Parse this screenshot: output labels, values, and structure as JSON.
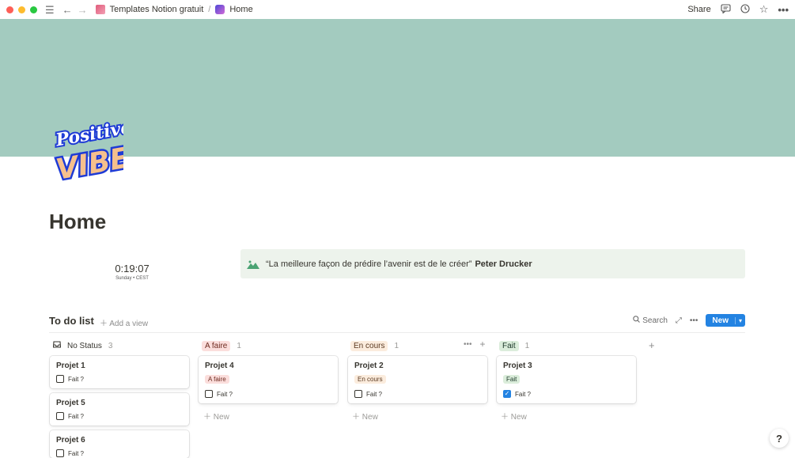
{
  "topbar": {
    "breadcrumb": [
      {
        "label": "Templates Notion gratuit"
      },
      {
        "label": "Home"
      }
    ],
    "separator": "/",
    "share_label": "Share"
  },
  "page": {
    "title": "Home",
    "icon_text_1": "Positive",
    "icon_text_2": "VIBES"
  },
  "clock": {
    "time": "0:19:07",
    "sub": "Sunday • CEST"
  },
  "callout": {
    "quote": "“La meilleure façon de prédire l’avenir est de le créer”",
    "author": "Peter Drucker"
  },
  "database": {
    "title": "To do list",
    "add_view": "Add a view",
    "search_label": "Search",
    "new_label": "New",
    "new_row_label": "New",
    "columns": [
      {
        "label": "No Status",
        "count": "3"
      },
      {
        "label": "A faire",
        "count": "1"
      },
      {
        "label": "En cours",
        "count": "1"
      },
      {
        "label": "Fait",
        "count": "1"
      }
    ],
    "cards": [
      {
        "name": "Projet 1",
        "tag": "",
        "check": "Fait ?"
      },
      {
        "name": "Projet 5",
        "tag": "",
        "check": "Fait ?"
      },
      {
        "name": "Projet 6",
        "tag": "",
        "check": "Fait ?"
      },
      {
        "name": "Projet 4",
        "tag": "A faire",
        "check": "Fait ?"
      },
      {
        "name": "Projet 2",
        "tag": "En cours",
        "check": "Fait ?"
      },
      {
        "name": "Projet 3",
        "tag": "Fait",
        "check": "Fait ?"
      }
    ]
  },
  "help_label": "?"
}
